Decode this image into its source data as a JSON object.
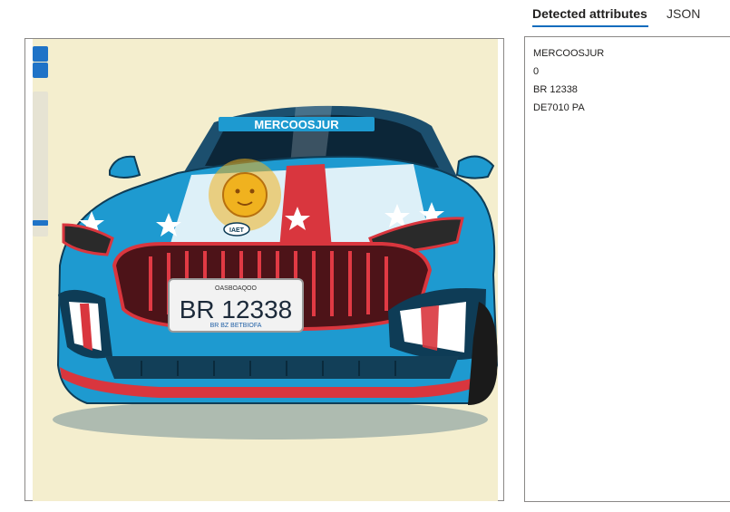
{
  "tabs": [
    {
      "label": "Detected attributes",
      "active": true
    },
    {
      "label": "JSON",
      "active": false
    }
  ],
  "attributes": [
    "MERCOOSJUR",
    "0",
    "BR 12338",
    "DE7010 PA"
  ],
  "image": {
    "windshield_text": "MERCOOSJUR",
    "plate_top_text": "OASBOAQOO",
    "plate_main_text": "BR 12338",
    "plate_bottom_text": "BR BZ BETBIOFA",
    "badge_text": "IAET"
  },
  "colors": {
    "accent": "#0f6cbd",
    "car_body": "#1e9ad0",
    "canvas_bg": "#f4eece",
    "stripe_red": "#d9363e",
    "sun_gold": "#f0b21f"
  }
}
